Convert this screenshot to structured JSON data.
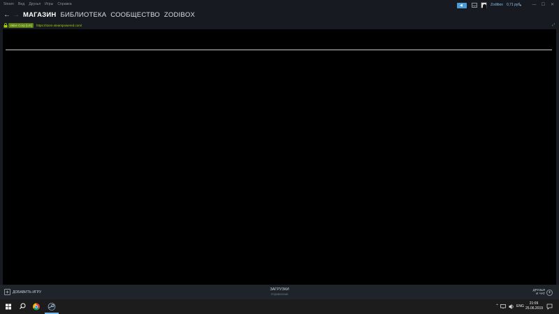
{
  "window": {
    "menu": [
      "Steam",
      "Вид",
      "Друзья",
      "Игры",
      "Справка"
    ],
    "user": {
      "name": "Zodibox",
      "balance": "0,71 руб."
    },
    "controls": [
      "—",
      "☐",
      "✕"
    ]
  },
  "nav": {
    "tabs": [
      "МАГАЗИН",
      "БИБЛИОТЕКА",
      "СООБЩЕСТВО",
      "ZODIBOX"
    ],
    "active_tab": 0
  },
  "urlbar": {
    "certificate": "Valve Corp [US]",
    "url": "https://store.steampowered.com/"
  },
  "footer": {
    "add_game": "ДОБАВИТЬ ИГРУ",
    "downloads_title": "ЗАГРУЗКИ",
    "downloads_sub": "Управление",
    "friends_line1": "ДРУЗЬЯ",
    "friends_line2": "И ЧАТ"
  },
  "taskbar": {
    "language": "ENG",
    "time": "21:09",
    "date": "25.06.2019",
    "apps": [
      "windows-start-icon",
      "search-icon",
      "chrome-icon",
      "steam-icon"
    ]
  },
  "colors": {
    "steam_bg": "#171a21",
    "content_bg": "#000000",
    "accent_blue": "#4c9bd6",
    "cert_green": "#5c7e10",
    "taskbar_bg": "#1c1c1c"
  }
}
